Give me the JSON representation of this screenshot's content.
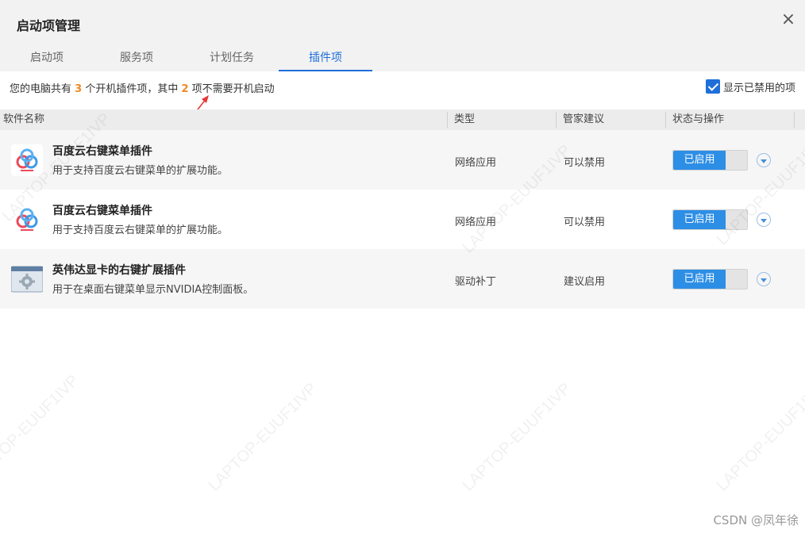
{
  "window": {
    "title": "启动项管理",
    "close_icon": "×"
  },
  "tabs": [
    {
      "label": "启动项",
      "active": false
    },
    {
      "label": "服务项",
      "active": false
    },
    {
      "label": "计划任务",
      "active": false
    },
    {
      "label": "插件项",
      "active": true
    }
  ],
  "summary": {
    "prefix": "您的电脑共有 ",
    "total": "3",
    "middle": " 个开机插件项，其中 ",
    "unneeded": "2",
    "suffix": " 项不需要开机启动"
  },
  "show_disabled": {
    "label": "显示已禁用的项",
    "checked": true
  },
  "columns": [
    "软件名称",
    "类型",
    "管家建议",
    "状态与操作"
  ],
  "rows": [
    {
      "icon": "baidu-cloud-icon",
      "name": "百度云右键菜单插件",
      "desc": "用于支持百度云右键菜单的扩展功能。",
      "type": "网络应用",
      "advice": "可以禁用",
      "status": "已启用"
    },
    {
      "icon": "baidu-cloud-icon",
      "name": "百度云右键菜单插件",
      "desc": "用于支持百度云右键菜单的扩展功能。",
      "type": "网络应用",
      "advice": "可以禁用",
      "status": "已启用"
    },
    {
      "icon": "settings-window-icon",
      "name": "英伟达显卡的右键扩展插件",
      "desc": "用于在桌面右键菜单显示NVIDIA控制面板。",
      "type": "驱动补丁",
      "advice": "建议启用",
      "status": "已启用"
    }
  ],
  "watermark": "LAPTOP-EUUF1IVP",
  "credit": "CSDN @凤年徐",
  "colors": {
    "accent": "#1e6fd9",
    "toggle_on": "#2d8ee6",
    "highlight_number": "#f08a24"
  }
}
